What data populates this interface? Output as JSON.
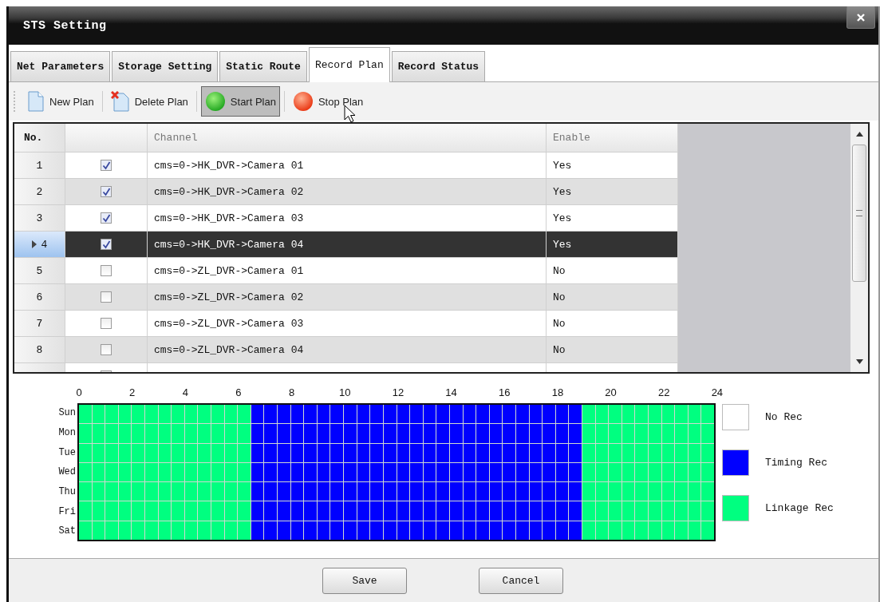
{
  "window": {
    "title": "STS Setting"
  },
  "tabs": [
    {
      "label": "Net Parameters",
      "selected": false
    },
    {
      "label": "Storage Setting",
      "selected": false
    },
    {
      "label": "Static Route",
      "selected": false
    },
    {
      "label": "Record Plan",
      "selected": true
    },
    {
      "label": "Record Status",
      "selected": false
    }
  ],
  "toolbar": [
    {
      "kind": "new",
      "label": "New Plan",
      "hovered": false
    },
    {
      "kind": "delete",
      "label": "Delete Plan",
      "hovered": false
    },
    {
      "kind": "start",
      "label": "Start Plan",
      "hovered": true
    },
    {
      "kind": "stop",
      "label": "Stop Plan",
      "hovered": false
    }
  ],
  "table": {
    "columns": [
      "No.",
      "Channel",
      "Enable"
    ],
    "rows": [
      {
        "no": "1",
        "checked": true,
        "channel": "cms=0->HK_DVR->Camera 01",
        "enable": "Yes",
        "selected": false
      },
      {
        "no": "2",
        "checked": true,
        "channel": "cms=0->HK_DVR->Camera 02",
        "enable": "Yes",
        "selected": false
      },
      {
        "no": "3",
        "checked": true,
        "channel": "cms=0->HK_DVR->Camera 03",
        "enable": "Yes",
        "selected": false
      },
      {
        "no": "4",
        "checked": true,
        "channel": "cms=0->HK_DVR->Camera 04",
        "enable": "Yes",
        "selected": true
      },
      {
        "no": "5",
        "checked": false,
        "channel": "cms=0->ZL_DVR->Camera 01",
        "enable": "No",
        "selected": false
      },
      {
        "no": "6",
        "checked": false,
        "channel": "cms=0->ZL_DVR->Camera 02",
        "enable": "No",
        "selected": false
      },
      {
        "no": "7",
        "checked": false,
        "channel": "cms=0->ZL_DVR->Camera 03",
        "enable": "No",
        "selected": false
      },
      {
        "no": "8",
        "checked": false,
        "channel": "cms=0->ZL_DVR->Camera 04",
        "enable": "No",
        "selected": false
      },
      {
        "selected": false
      }
    ]
  },
  "schedule": {
    "hours": [
      "0",
      "2",
      "4",
      "6",
      "8",
      "10",
      "12",
      "14",
      "16",
      "18",
      "20",
      "22",
      "24"
    ],
    "days": [
      {
        "label": "Sun",
        "slots": [
          {
            "kind": "link"
          },
          {
            "kind": "link"
          },
          {
            "kind": "link"
          },
          {
            "kind": "link"
          },
          {
            "kind": "link"
          },
          {
            "kind": "link"
          },
          {
            "kind": "link"
          },
          {
            "kind": "link"
          },
          {
            "kind": "link"
          },
          {
            "kind": "link"
          },
          {
            "kind": "link"
          },
          {
            "kind": "link"
          },
          {
            "kind": "link"
          },
          {
            "kind": "time"
          },
          {
            "kind": "time"
          },
          {
            "kind": "time"
          },
          {
            "kind": "time"
          },
          {
            "kind": "time"
          },
          {
            "kind": "time"
          },
          {
            "kind": "time"
          },
          {
            "kind": "time"
          },
          {
            "kind": "time"
          },
          {
            "kind": "time"
          },
          {
            "kind": "time"
          },
          {
            "kind": "time"
          },
          {
            "kind": "time"
          },
          {
            "kind": "time"
          },
          {
            "kind": "time"
          },
          {
            "kind": "time"
          },
          {
            "kind": "time"
          },
          {
            "kind": "time"
          },
          {
            "kind": "time"
          },
          {
            "kind": "time"
          },
          {
            "kind": "time"
          },
          {
            "kind": "time"
          },
          {
            "kind": "time"
          },
          {
            "kind": "time"
          },
          {
            "kind": "time"
          },
          {
            "kind": "link"
          },
          {
            "kind": "link"
          },
          {
            "kind": "link"
          },
          {
            "kind": "link"
          },
          {
            "kind": "link"
          },
          {
            "kind": "link"
          },
          {
            "kind": "link"
          },
          {
            "kind": "link"
          },
          {
            "kind": "link"
          },
          {
            "kind": "link"
          }
        ]
      },
      {
        "label": "Mon",
        "slots": [
          {
            "kind": "link"
          },
          {
            "kind": "link"
          },
          {
            "kind": "link"
          },
          {
            "kind": "link"
          },
          {
            "kind": "link"
          },
          {
            "kind": "link"
          },
          {
            "kind": "link"
          },
          {
            "kind": "link"
          },
          {
            "kind": "link"
          },
          {
            "kind": "link"
          },
          {
            "kind": "link"
          },
          {
            "kind": "link"
          },
          {
            "kind": "link"
          },
          {
            "kind": "time"
          },
          {
            "kind": "time"
          },
          {
            "kind": "time"
          },
          {
            "kind": "time"
          },
          {
            "kind": "time"
          },
          {
            "kind": "time"
          },
          {
            "kind": "time"
          },
          {
            "kind": "time"
          },
          {
            "kind": "time"
          },
          {
            "kind": "time"
          },
          {
            "kind": "time"
          },
          {
            "kind": "time"
          },
          {
            "kind": "time"
          },
          {
            "kind": "time"
          },
          {
            "kind": "time"
          },
          {
            "kind": "time"
          },
          {
            "kind": "time"
          },
          {
            "kind": "time"
          },
          {
            "kind": "time"
          },
          {
            "kind": "time"
          },
          {
            "kind": "time"
          },
          {
            "kind": "time"
          },
          {
            "kind": "time"
          },
          {
            "kind": "time"
          },
          {
            "kind": "time"
          },
          {
            "kind": "link"
          },
          {
            "kind": "link"
          },
          {
            "kind": "link"
          },
          {
            "kind": "link"
          },
          {
            "kind": "link"
          },
          {
            "kind": "link"
          },
          {
            "kind": "link"
          },
          {
            "kind": "link"
          },
          {
            "kind": "link"
          },
          {
            "kind": "link"
          }
        ]
      },
      {
        "label": "Tue",
        "slots": [
          {
            "kind": "link"
          },
          {
            "kind": "link"
          },
          {
            "kind": "link"
          },
          {
            "kind": "link"
          },
          {
            "kind": "link"
          },
          {
            "kind": "link"
          },
          {
            "kind": "link"
          },
          {
            "kind": "link"
          },
          {
            "kind": "link"
          },
          {
            "kind": "link"
          },
          {
            "kind": "link"
          },
          {
            "kind": "link"
          },
          {
            "kind": "link"
          },
          {
            "kind": "time"
          },
          {
            "kind": "time"
          },
          {
            "kind": "time"
          },
          {
            "kind": "time"
          },
          {
            "kind": "time"
          },
          {
            "kind": "time"
          },
          {
            "kind": "time"
          },
          {
            "kind": "time"
          },
          {
            "kind": "time"
          },
          {
            "kind": "time"
          },
          {
            "kind": "time"
          },
          {
            "kind": "time"
          },
          {
            "kind": "time"
          },
          {
            "kind": "time"
          },
          {
            "kind": "time"
          },
          {
            "kind": "time"
          },
          {
            "kind": "time"
          },
          {
            "kind": "time"
          },
          {
            "kind": "time"
          },
          {
            "kind": "time"
          },
          {
            "kind": "time"
          },
          {
            "kind": "time"
          },
          {
            "kind": "time"
          },
          {
            "kind": "time"
          },
          {
            "kind": "time"
          },
          {
            "kind": "link"
          },
          {
            "kind": "link"
          },
          {
            "kind": "link"
          },
          {
            "kind": "link"
          },
          {
            "kind": "link"
          },
          {
            "kind": "link"
          },
          {
            "kind": "link"
          },
          {
            "kind": "link"
          },
          {
            "kind": "link"
          },
          {
            "kind": "link"
          }
        ]
      },
      {
        "label": "Wed",
        "slots": [
          {
            "kind": "link"
          },
          {
            "kind": "link"
          },
          {
            "kind": "link"
          },
          {
            "kind": "link"
          },
          {
            "kind": "link"
          },
          {
            "kind": "link"
          },
          {
            "kind": "link"
          },
          {
            "kind": "link"
          },
          {
            "kind": "link"
          },
          {
            "kind": "link"
          },
          {
            "kind": "link"
          },
          {
            "kind": "link"
          },
          {
            "kind": "link"
          },
          {
            "kind": "time"
          },
          {
            "kind": "time"
          },
          {
            "kind": "time"
          },
          {
            "kind": "time"
          },
          {
            "kind": "time"
          },
          {
            "kind": "time"
          },
          {
            "kind": "time"
          },
          {
            "kind": "time"
          },
          {
            "kind": "time"
          },
          {
            "kind": "time"
          },
          {
            "kind": "time"
          },
          {
            "kind": "time"
          },
          {
            "kind": "time"
          },
          {
            "kind": "time"
          },
          {
            "kind": "time"
          },
          {
            "kind": "time"
          },
          {
            "kind": "time"
          },
          {
            "kind": "time"
          },
          {
            "kind": "time"
          },
          {
            "kind": "time"
          },
          {
            "kind": "time"
          },
          {
            "kind": "time"
          },
          {
            "kind": "time"
          },
          {
            "kind": "time"
          },
          {
            "kind": "time"
          },
          {
            "kind": "link"
          },
          {
            "kind": "link"
          },
          {
            "kind": "link"
          },
          {
            "kind": "link"
          },
          {
            "kind": "link"
          },
          {
            "kind": "link"
          },
          {
            "kind": "link"
          },
          {
            "kind": "link"
          },
          {
            "kind": "link"
          },
          {
            "kind": "link"
          }
        ]
      },
      {
        "label": "Thu",
        "slots": [
          {
            "kind": "link"
          },
          {
            "kind": "link"
          },
          {
            "kind": "link"
          },
          {
            "kind": "link"
          },
          {
            "kind": "link"
          },
          {
            "kind": "link"
          },
          {
            "kind": "link"
          },
          {
            "kind": "link"
          },
          {
            "kind": "link"
          },
          {
            "kind": "link"
          },
          {
            "kind": "link"
          },
          {
            "kind": "link"
          },
          {
            "kind": "link"
          },
          {
            "kind": "time"
          },
          {
            "kind": "time"
          },
          {
            "kind": "time"
          },
          {
            "kind": "time"
          },
          {
            "kind": "time"
          },
          {
            "kind": "time"
          },
          {
            "kind": "time"
          },
          {
            "kind": "time"
          },
          {
            "kind": "time"
          },
          {
            "kind": "time"
          },
          {
            "kind": "time"
          },
          {
            "kind": "time"
          },
          {
            "kind": "time"
          },
          {
            "kind": "time"
          },
          {
            "kind": "time"
          },
          {
            "kind": "time"
          },
          {
            "kind": "time"
          },
          {
            "kind": "time"
          },
          {
            "kind": "time"
          },
          {
            "kind": "time"
          },
          {
            "kind": "time"
          },
          {
            "kind": "time"
          },
          {
            "kind": "time"
          },
          {
            "kind": "time"
          },
          {
            "kind": "time"
          },
          {
            "kind": "link"
          },
          {
            "kind": "link"
          },
          {
            "kind": "link"
          },
          {
            "kind": "link"
          },
          {
            "kind": "link"
          },
          {
            "kind": "link"
          },
          {
            "kind": "link"
          },
          {
            "kind": "link"
          },
          {
            "kind": "link"
          },
          {
            "kind": "link"
          }
        ]
      },
      {
        "label": "Fri",
        "slots": [
          {
            "kind": "link"
          },
          {
            "kind": "link"
          },
          {
            "kind": "link"
          },
          {
            "kind": "link"
          },
          {
            "kind": "link"
          },
          {
            "kind": "link"
          },
          {
            "kind": "link"
          },
          {
            "kind": "link"
          },
          {
            "kind": "link"
          },
          {
            "kind": "link"
          },
          {
            "kind": "link"
          },
          {
            "kind": "link"
          },
          {
            "kind": "link"
          },
          {
            "kind": "time"
          },
          {
            "kind": "time"
          },
          {
            "kind": "time"
          },
          {
            "kind": "time"
          },
          {
            "kind": "time"
          },
          {
            "kind": "time"
          },
          {
            "kind": "time"
          },
          {
            "kind": "time"
          },
          {
            "kind": "time"
          },
          {
            "kind": "time"
          },
          {
            "kind": "time"
          },
          {
            "kind": "time"
          },
          {
            "kind": "time"
          },
          {
            "kind": "time"
          },
          {
            "kind": "time"
          },
          {
            "kind": "time"
          },
          {
            "kind": "time"
          },
          {
            "kind": "time"
          },
          {
            "kind": "time"
          },
          {
            "kind": "time"
          },
          {
            "kind": "time"
          },
          {
            "kind": "time"
          },
          {
            "kind": "time"
          },
          {
            "kind": "time"
          },
          {
            "kind": "time"
          },
          {
            "kind": "link"
          },
          {
            "kind": "link"
          },
          {
            "kind": "link"
          },
          {
            "kind": "link"
          },
          {
            "kind": "link"
          },
          {
            "kind": "link"
          },
          {
            "kind": "link"
          },
          {
            "kind": "link"
          },
          {
            "kind": "link"
          },
          {
            "kind": "link"
          }
        ]
      },
      {
        "label": "Sat",
        "slots": [
          {
            "kind": "link"
          },
          {
            "kind": "link"
          },
          {
            "kind": "link"
          },
          {
            "kind": "link"
          },
          {
            "kind": "link"
          },
          {
            "kind": "link"
          },
          {
            "kind": "link"
          },
          {
            "kind": "link"
          },
          {
            "kind": "link"
          },
          {
            "kind": "link"
          },
          {
            "kind": "link"
          },
          {
            "kind": "link"
          },
          {
            "kind": "link"
          },
          {
            "kind": "time"
          },
          {
            "kind": "time"
          },
          {
            "kind": "time"
          },
          {
            "kind": "time"
          },
          {
            "kind": "time"
          },
          {
            "kind": "time"
          },
          {
            "kind": "time"
          },
          {
            "kind": "time"
          },
          {
            "kind": "time"
          },
          {
            "kind": "time"
          },
          {
            "kind": "time"
          },
          {
            "kind": "time"
          },
          {
            "kind": "time"
          },
          {
            "kind": "time"
          },
          {
            "kind": "time"
          },
          {
            "kind": "time"
          },
          {
            "kind": "time"
          },
          {
            "kind": "time"
          },
          {
            "kind": "time"
          },
          {
            "kind": "time"
          },
          {
            "kind": "time"
          },
          {
            "kind": "time"
          },
          {
            "kind": "time"
          },
          {
            "kind": "time"
          },
          {
            "kind": "time"
          },
          {
            "kind": "link"
          },
          {
            "kind": "link"
          },
          {
            "kind": "link"
          },
          {
            "kind": "link"
          },
          {
            "kind": "link"
          },
          {
            "kind": "link"
          },
          {
            "kind": "link"
          },
          {
            "kind": "link"
          },
          {
            "kind": "link"
          },
          {
            "kind": "link"
          }
        ]
      }
    ],
    "legend": [
      {
        "kind": "none",
        "label": "No Rec",
        "color": "#ffffff"
      },
      {
        "kind": "time",
        "label": "Timing Rec",
        "color": "#0000ff"
      },
      {
        "kind": "link",
        "label": "Linkage Rec",
        "color": "#00ff80"
      }
    ]
  },
  "buttons": [
    "Save",
    "Cancel"
  ]
}
